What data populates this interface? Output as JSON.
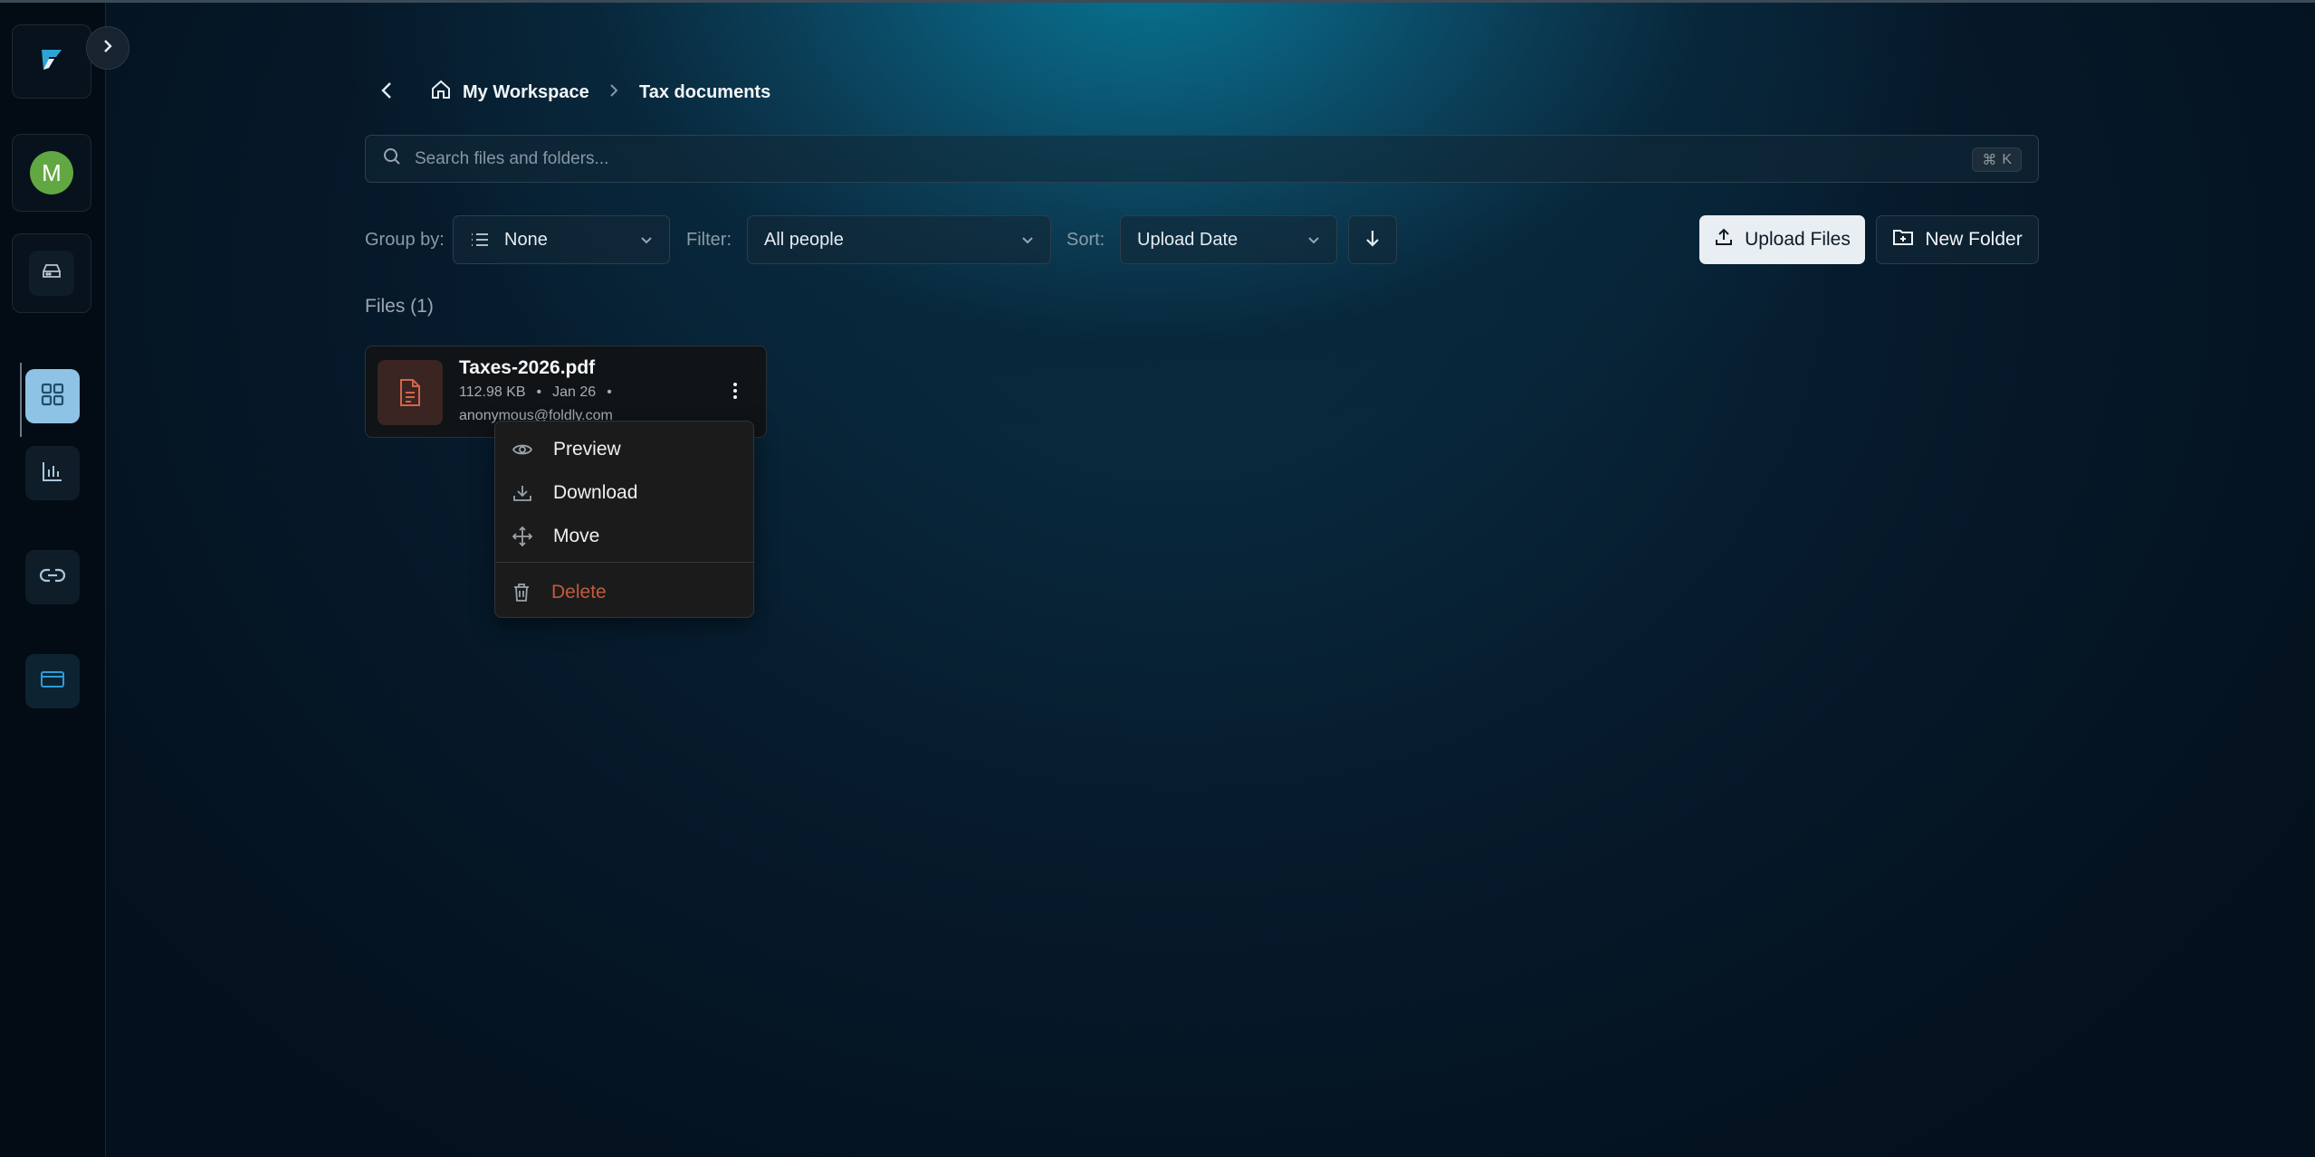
{
  "breadcrumb": {
    "home_label": "My Workspace",
    "current_label": "Tax documents"
  },
  "search": {
    "placeholder": "Search files and folders...",
    "shortcut_symbol": "⌘",
    "shortcut_key": "K"
  },
  "toolbar": {
    "group_label": "Group by:",
    "group_value": "None",
    "filter_label": "Filter:",
    "filter_value": "All people",
    "sort_label": "Sort:",
    "sort_value": "Upload Date",
    "upload_label": "Upload Files",
    "new_folder_label": "New Folder"
  },
  "files": {
    "heading": "Files (1)",
    "items": [
      {
        "name": "Taxes-2026.pdf",
        "size": "112.98 KB",
        "date": "Jan 26",
        "owner": "anonymous@foldly.com"
      }
    ]
  },
  "sidebar": {
    "avatar_initial": "M",
    "icons": [
      "logo-icon",
      "chevron-right-icon",
      "drive-icon",
      "grid-icon",
      "bar-chart-icon",
      "link-icon",
      "card-icon"
    ]
  },
  "context_menu": {
    "items": [
      {
        "label": "Preview",
        "icon": "eye-icon"
      },
      {
        "label": "Download",
        "icon": "download-icon"
      },
      {
        "label": "Move",
        "icon": "move-icon"
      },
      {
        "label": "Delete",
        "icon": "trash-icon"
      }
    ]
  },
  "colors": {
    "accent": "#8fc3e6",
    "danger": "#c45a3a",
    "avatar": "#62a842",
    "pdf_icon": "#d2664a"
  }
}
